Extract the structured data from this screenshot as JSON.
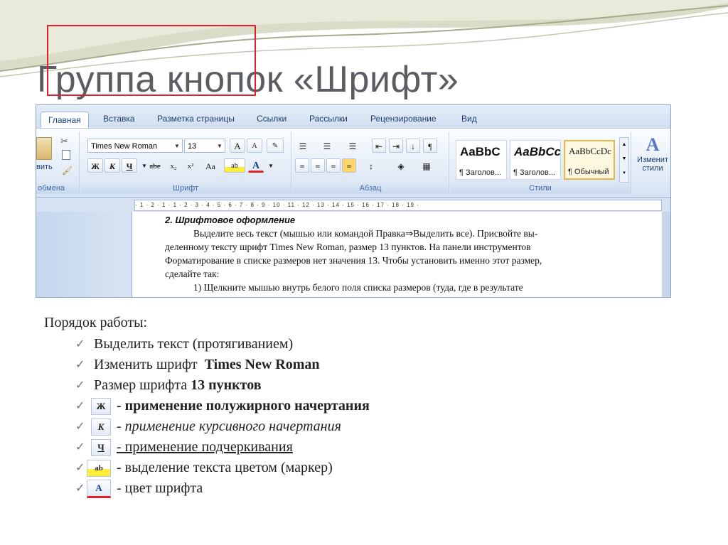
{
  "slide_title": "Группа кнопок «Шрифт»",
  "tabs": [
    "Главная",
    "Вставка",
    "Разметка страницы",
    "Ссылки",
    "Рассылки",
    "Рецензирование",
    "Вид"
  ],
  "clipboard": {
    "paste_label": "вить",
    "group_label": "обмена"
  },
  "font_group": {
    "font_name": "Times New Roman",
    "font_size": "13",
    "grow_label": "A",
    "shrink_label": "A",
    "bold": "Ж",
    "italic": "К",
    "underline": "Ч",
    "strike": "abe",
    "subscript": "x₂",
    "superscript": "x²",
    "case": "Aa",
    "highlight": "ab",
    "color": "A",
    "group_label": "Шрифт"
  },
  "paragraph_group": {
    "group_label": "Абзац"
  },
  "styles_group": {
    "items": [
      {
        "preview": "AaBbC",
        "name": "¶ Заголов..."
      },
      {
        "preview": "AaBbCc",
        "name": "¶ Заголов..."
      },
      {
        "preview": "AaBbCcDc",
        "name": "¶ Обычный"
      }
    ],
    "change_label_1": "Изменит",
    "change_label_2": "стили",
    "group_label": "Стили"
  },
  "ruler_text": "· 1 · 2 · 1 · 1 · 2 · 3 · 4 · 5 · 6 · 7 · 8 · 9 · 10 · 11 · 12 · 13 · 14 · 15 · 16 · 17 · 18 · 19 ·",
  "document": {
    "heading": "2. Шрифтовое оформление",
    "line1": "Выделите весь текст (мышью или командой Правка⇒Выделить все). Присвойте вы-",
    "line2": "деленному тексту шрифт Times New Roman, размер 13 пунктов. На панели инструментов",
    "line3": "Форматирование в списке размеров нет значения 13. Чтобы установить именно этот размер,",
    "line4": "сделайте так:",
    "line5": "1) Щелкните мышью внутрь белого поля списка размеров (туда, где в результате"
  },
  "procedure": {
    "heading": "Порядок работы:",
    "items": [
      {
        "text": "Выделить  текст (протягиванием)"
      },
      {
        "prefix": "Изменить шрифт  ",
        "bold": "Times New Roman"
      },
      {
        "prefix": "Размер шрифта ",
        "bold": "13 пунктов"
      },
      {
        "icon": "Ж",
        "text": "- применение полужирного начертания"
      },
      {
        "icon": "К",
        "text": "- применение курсивного начертания"
      },
      {
        "icon": "Ч",
        "text": "- применение подчеркивания"
      },
      {
        "icon": "ab",
        "text": "- выделение текста цветом (маркер)"
      },
      {
        "icon": "A",
        "text": "- цвет шрифта"
      }
    ]
  },
  "colors": {
    "accent_red": "#e0202a",
    "title_gray": "#5a5e63"
  }
}
